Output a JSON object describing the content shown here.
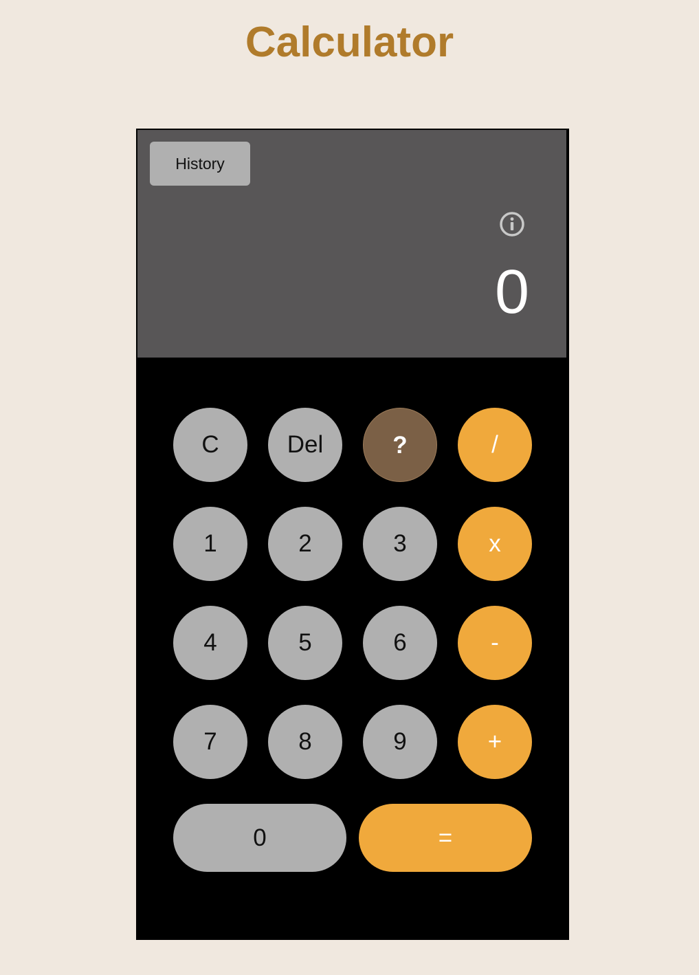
{
  "page": {
    "title": "Calculator"
  },
  "display": {
    "history_label": "History",
    "info_icon": "info-icon",
    "value": "0"
  },
  "keypad": {
    "row1": [
      "C",
      "Del",
      "?",
      "/"
    ],
    "row2": [
      "1",
      "2",
      "3",
      "x"
    ],
    "row3": [
      "4",
      "5",
      "6",
      "-"
    ],
    "row4": [
      "7",
      "8",
      "9",
      "+"
    ],
    "row5": [
      "0",
      "="
    ]
  },
  "colors": {
    "background": "#f0e8df",
    "title": "#b07b2b",
    "display_bg": "#585657",
    "keypad_bg": "#000000",
    "key_gray": "#b0b0b0",
    "key_orange": "#f0a93c",
    "key_brown": "#7b6046"
  }
}
